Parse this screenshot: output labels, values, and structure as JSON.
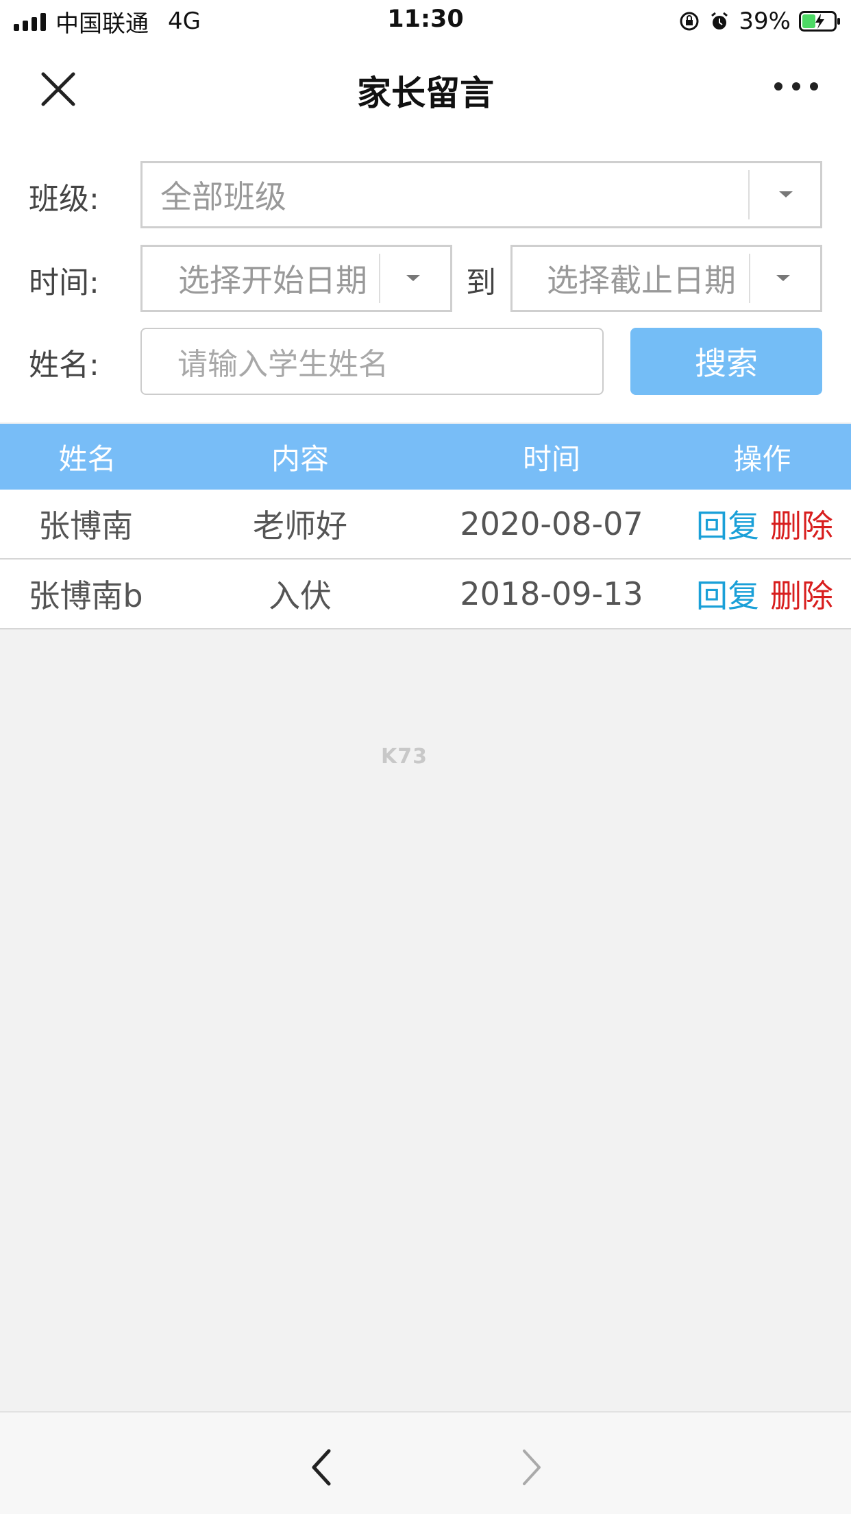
{
  "status_bar": {
    "carrier": "中国联通",
    "network": "4G",
    "time": "11:30",
    "battery": "39%",
    "icons": [
      "signal-icon",
      "rotation-lock-icon",
      "alarm-icon",
      "battery-charging-icon"
    ]
  },
  "nav": {
    "title": "家长留言",
    "icons": [
      "close-icon",
      "more-icon"
    ]
  },
  "filters": {
    "class_label": "班级:",
    "class_value": "全部班级",
    "time_label": "时间:",
    "start_placeholder": "选择开始日期",
    "to_label": "到",
    "end_placeholder": "选择截止日期",
    "name_label": "姓名:",
    "name_placeholder": "请输入学生姓名",
    "search_label": "搜索"
  },
  "table": {
    "headers": [
      "姓名",
      "内容",
      "时间",
      "操作"
    ],
    "rows": [
      {
        "name": "张博南",
        "content": "老师好",
        "time": "2020-08-07",
        "reply": "回复",
        "delete": "删除"
      },
      {
        "name": "张博南b",
        "content": "入伏",
        "time": "2018-09-13",
        "reply": "回复",
        "delete": "删除"
      }
    ]
  },
  "watermark": "K73",
  "colors": {
    "accent": "#74bdf6",
    "reply": "#1aa0d8",
    "delete": "#d81e1e",
    "battery_fill": "#4cd964"
  },
  "bottom_bar": {
    "icons": [
      "back-arrow-icon",
      "forward-arrow-icon"
    ]
  }
}
